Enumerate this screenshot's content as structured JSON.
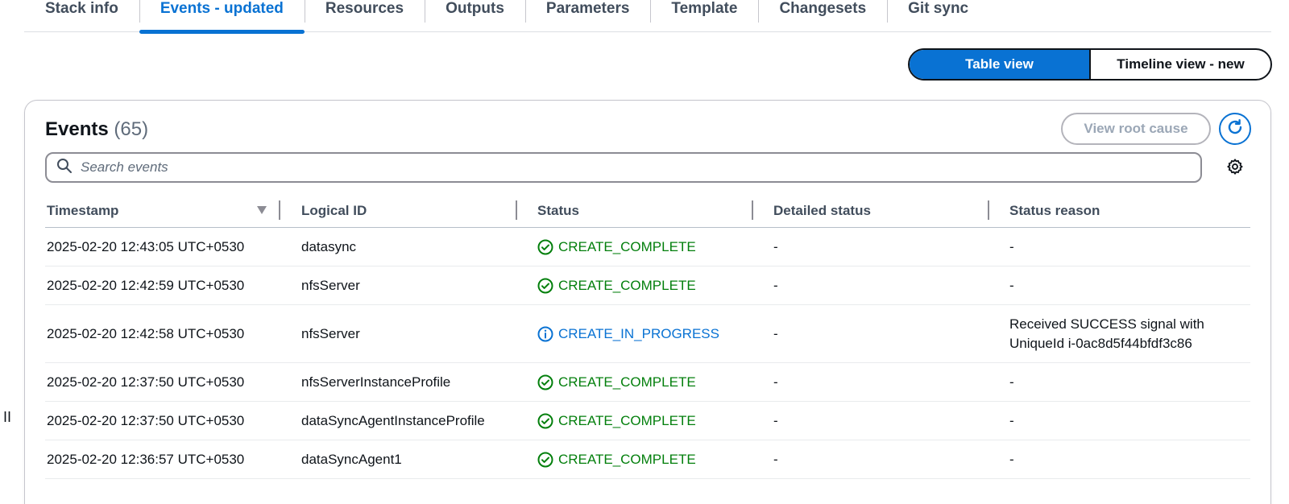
{
  "tabs": [
    {
      "label": "Stack info"
    },
    {
      "label": "Events - updated"
    },
    {
      "label": "Resources"
    },
    {
      "label": "Outputs"
    },
    {
      "label": "Parameters"
    },
    {
      "label": "Template"
    },
    {
      "label": "Changesets"
    },
    {
      "label": "Git sync"
    }
  ],
  "active_tab": "Events - updated",
  "view_toggle": {
    "table": "Table view",
    "timeline": "Timeline view - new",
    "selected": "Table view"
  },
  "events": {
    "title": "Events",
    "count": "(65)",
    "view_root_cause": "View root cause",
    "search_placeholder": "Search events",
    "columns": {
      "timestamp": "Timestamp",
      "logical_id": "Logical ID",
      "status": "Status",
      "detailed_status": "Detailed status",
      "status_reason": "Status reason"
    },
    "rows": [
      {
        "timestamp": "2025-02-20 12:43:05 UTC+0530",
        "logical_id": "datasync",
        "status": "CREATE_COMPLETE",
        "detailed_status": "-",
        "status_reason": "-"
      },
      {
        "timestamp": "2025-02-20 12:42:59 UTC+0530",
        "logical_id": "nfsServer",
        "status": "CREATE_COMPLETE",
        "detailed_status": "-",
        "status_reason": "-"
      },
      {
        "timestamp": "2025-02-20 12:42:58 UTC+0530",
        "logical_id": "nfsServer",
        "status": "CREATE_IN_PROGRESS",
        "detailed_status": "-",
        "status_reason": "Received SUCCESS signal with UniqueId i-0ac8d5f44bfdf3c86"
      },
      {
        "timestamp": "2025-02-20 12:37:50 UTC+0530",
        "logical_id": "nfsServerInstanceProfile",
        "status": "CREATE_COMPLETE",
        "detailed_status": "-",
        "status_reason": "-"
      },
      {
        "timestamp": "2025-02-20 12:37:50 UTC+0530",
        "logical_id": "dataSyncAgentInstanceProfile",
        "status": "CREATE_COMPLETE",
        "detailed_status": "-",
        "status_reason": "-"
      },
      {
        "timestamp": "2025-02-20 12:36:57 UTC+0530",
        "logical_id": "dataSyncAgent1",
        "status": "CREATE_COMPLETE",
        "detailed_status": "-",
        "status_reason": "-"
      }
    ]
  },
  "icons": {
    "search": "search-icon",
    "settings": "gear-icon",
    "refresh": "refresh-icon",
    "sort": "sort-descending-icon",
    "status_complete": "check-circle-icon",
    "status_progress": "info-circle-icon",
    "resize": "drag-handle-icon"
  },
  "colors": {
    "accent": "#0972d3",
    "success": "#037f0c",
    "text": "#0f141a",
    "muted": "#5f6b7a"
  },
  "resize_handle_glyph": "II"
}
